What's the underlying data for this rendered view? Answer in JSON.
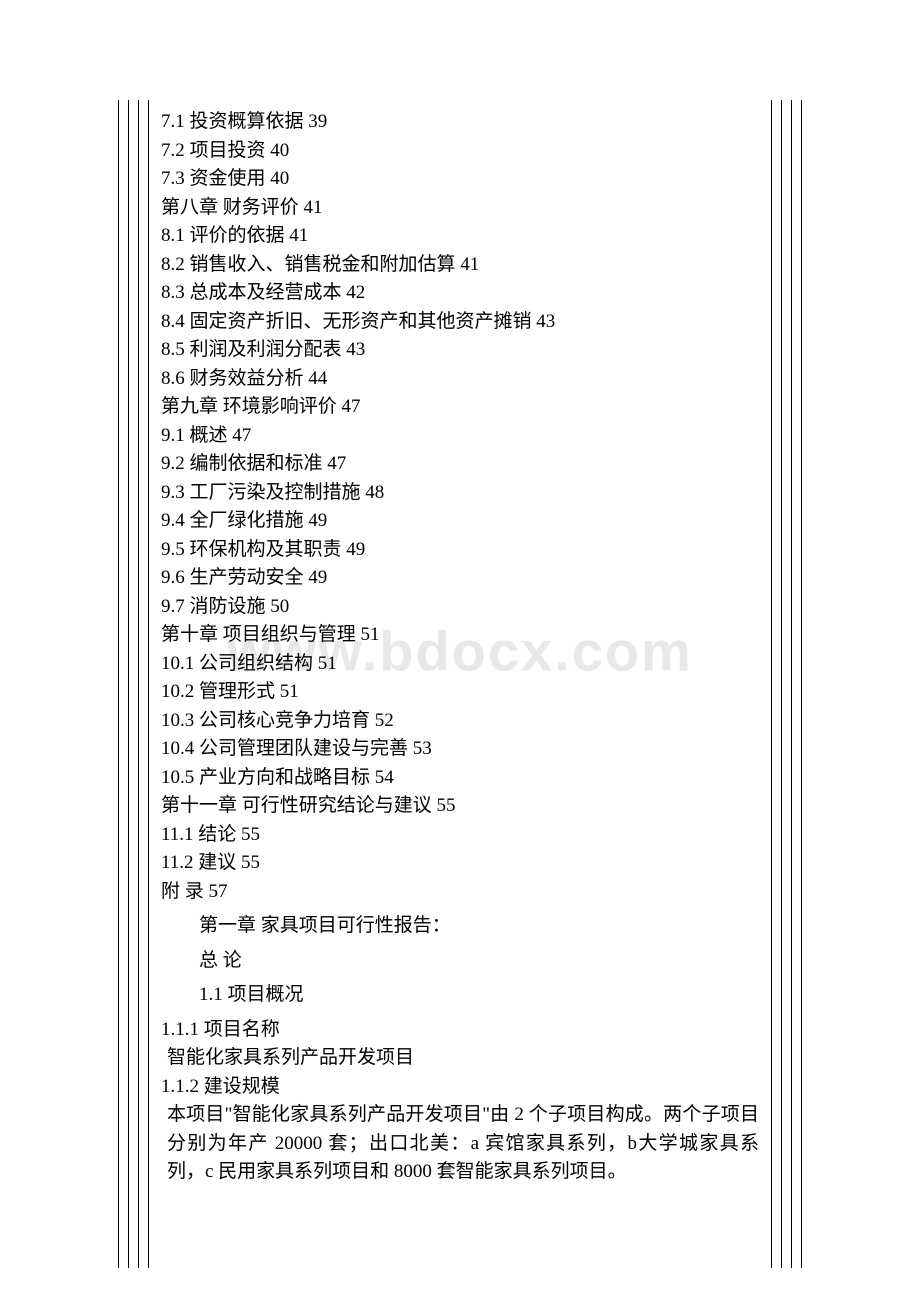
{
  "watermark": "www.bdocx.com",
  "toc": [
    "7.1 投资概算依据 39",
    "7.2 项目投资 40",
    "7.3 资金使用 40",
    "第八章 财务评价 41",
    "8.1 评价的依据 41",
    "8.2 销售收入、销售税金和附加估算 41",
    "8.3 总成本及经营成本 42",
    "8.4 固定资产折旧、无形资产和其他资产摊销 43",
    "8.5 利润及利润分配表 43",
    "8.6 财务效益分析 44",
    "第九章 环境影响评价 47",
    "9.1 概述 47",
    "9.2 编制依据和标准 47",
    "9.3 工厂污染及控制措施 48",
    "9.4 全厂绿化措施 49",
    "9.5 环保机构及其职责 49",
    "9.6 生产劳动安全 49",
    "9.7 消防设施 50",
    "第十章 项目组织与管理 51",
    "10.1 公司组织结构 51",
    "10.2 管理形式 51",
    "10.3 公司核心竞争力培育 52",
    "10.4 公司管理团队建设与完善 53",
    "10.5 产业方向和战略目标 54",
    "第十一章 可行性研究结论与建议 55",
    "11.1 结论 55",
    "11.2 建议 55",
    "附  录 57"
  ],
  "sections": {
    "chapter1": "第一章 家具项目可行性报告：",
    "general": "总 论",
    "overview": "1.1 项目概况"
  },
  "body": {
    "h111": "1.1.1 项目名称",
    "p111": " 智能化家具系列产品开发项目",
    "h112": "1.1.2 建设规模",
    "p112": " 本项目\"智能化家具系列产品开发项目\"由 2 个子项目构成。两个子项目分别为年产 20000 套；出口北美：a 宾馆家具系列，b大学城家具系列，c 民用家具系列项目和 8000 套智能家具系列项目。"
  }
}
